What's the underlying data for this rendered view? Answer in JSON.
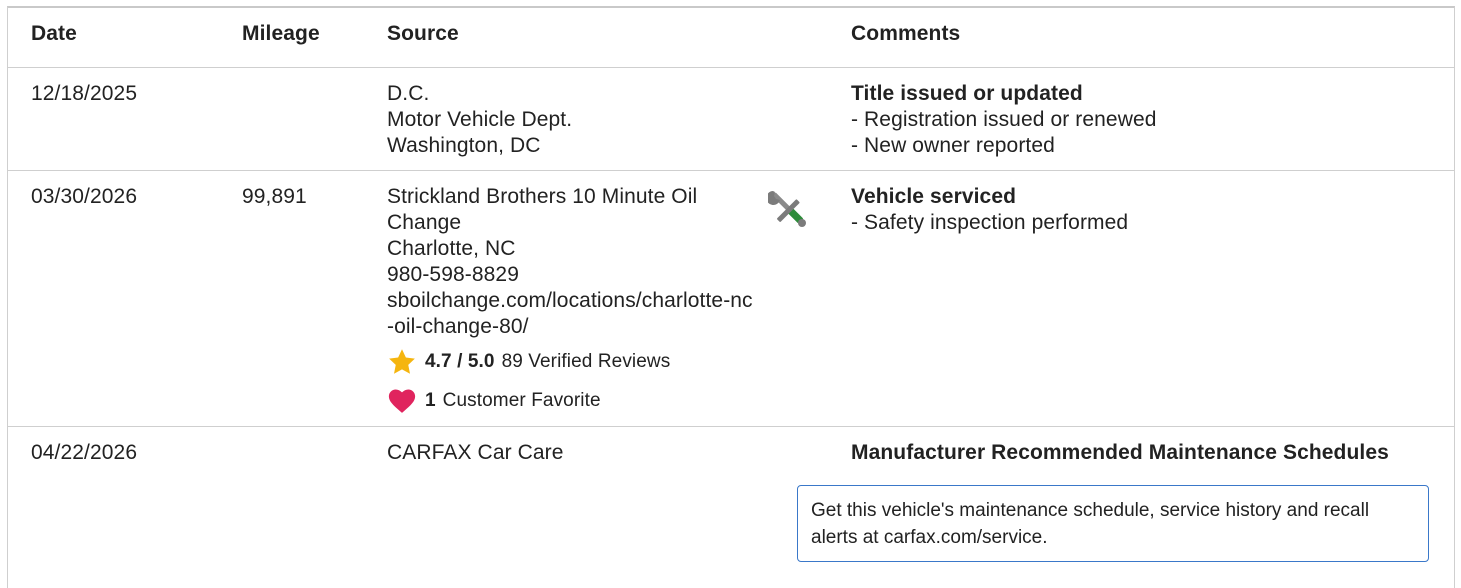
{
  "headers": {
    "date": "Date",
    "mileage": "Mileage",
    "source": "Source",
    "comments": "Comments"
  },
  "rows": [
    {
      "date": "12/18/2025",
      "mileage": "",
      "source_lines": [
        "D.C.",
        "Motor Vehicle Dept.",
        "Washington, DC"
      ],
      "comment_title": "Title issued or updated",
      "comment_items": [
        "Registration issued or renewed",
        "New owner reported"
      ]
    },
    {
      "date": "03/30/2026",
      "mileage": "99,891",
      "source_name": "Strickland Brothers 10 Minute Oil Change",
      "source_city": "Charlotte, NC",
      "source_phone": "980-598-8829",
      "source_url": "sboilchange.com/locations/charlotte-nc-oil-change-80/",
      "rating_value": "4.7 / 5.0",
      "rating_reviews": "89 Verified Reviews",
      "favorite_count": "1",
      "favorite_label": "Customer Favorite",
      "icon": "service-tools-icon",
      "comment_title": "Vehicle serviced",
      "comment_items": [
        "Safety inspection performed"
      ]
    },
    {
      "date": "04/22/2026",
      "mileage": "",
      "source_name": "CARFAX Car Care",
      "comment_title": "Manufacturer Recommended Maintenance Schedules",
      "notice_text": "Get this vehicle's maintenance schedule, service history and recall alerts at carfax.com/service."
    }
  ],
  "icons": {
    "rating": "star-icon",
    "favorite": "heart-icon"
  },
  "colors": {
    "star": "#f5b50f",
    "heart": "#e0245e",
    "notice_border": "#3a78c9",
    "tool_green": "#2e8b3a"
  }
}
